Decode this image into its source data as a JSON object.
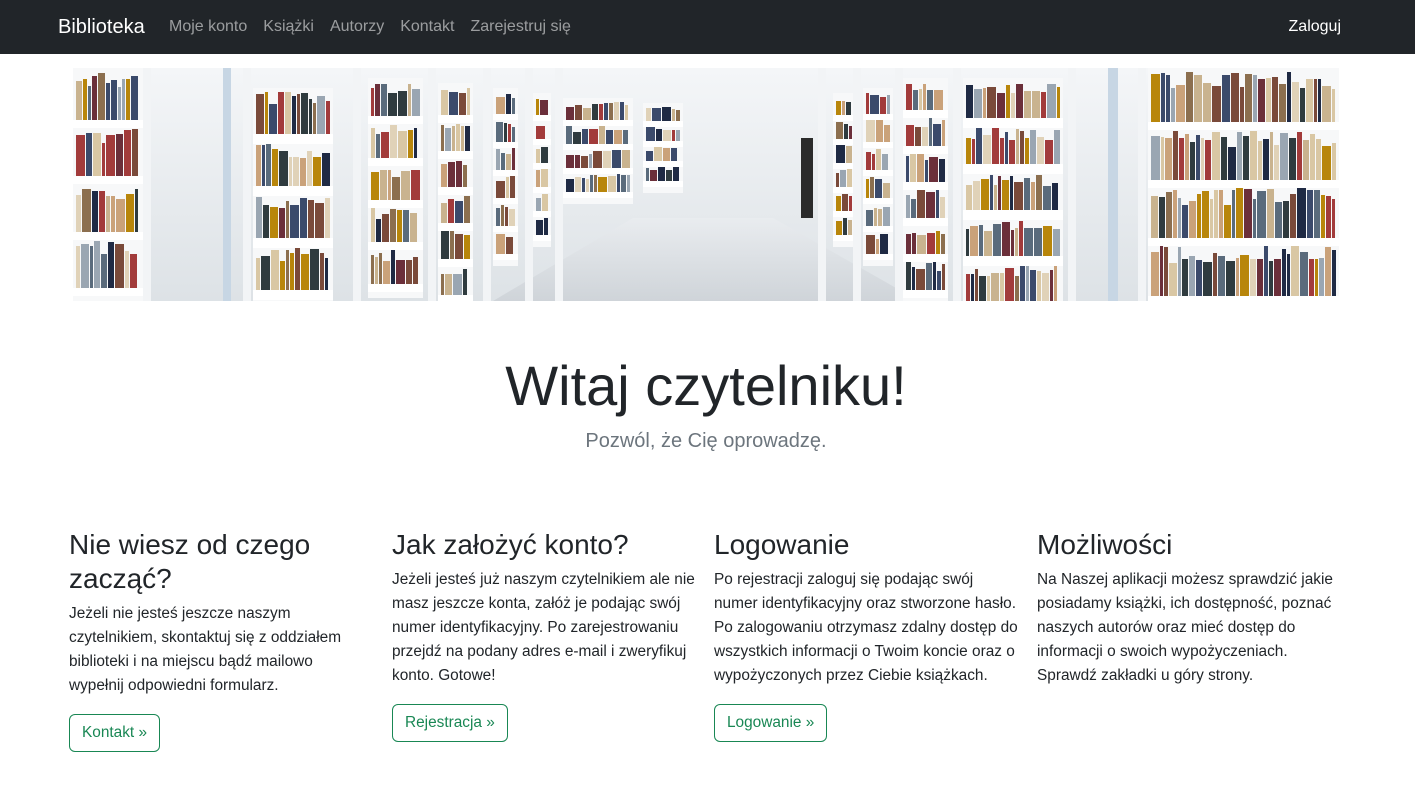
{
  "navbar": {
    "brand": "Biblioteka",
    "links": [
      "Moje konto",
      "Książki",
      "Autorzy",
      "Kontakt",
      "Zarejestruj się"
    ],
    "login": "Zaloguj"
  },
  "hero": {
    "title": "Witaj czytelniku!",
    "subtitle": "Pozwól, że Cię oprowadzę."
  },
  "features": [
    {
      "heading": "Nie wiesz od czego zacząć?",
      "text": "Jeżeli nie jesteś jeszcze naszym czytelnikiem, skontaktuj się z oddziałem biblioteki i na miejscu bądź mailowo wypełnij odpowiedni formularz.",
      "button": "Kontakt »"
    },
    {
      "heading": "Jak założyć konto?",
      "text": "Jeżeli jesteś już naszym czytelnikiem ale nie masz jeszcze konta, załóż je podając swój numer identyfikacyjny. Po zarejestrowaniu przejdź na podany adres e-mail i zweryfikuj konto. Gotowe!",
      "button": "Rejestracja »"
    },
    {
      "heading": "Logowanie",
      "text": "Po rejestracji zaloguj się podając swój numer identyfikacyjny oraz stworzone hasło. Po zalogowaniu otrzymasz zdalny dostęp do wszystkich informacji o Twoim koncie oraz o wypożyczonych przez Ciebie książkach.",
      "button": "Logowanie »"
    },
    {
      "heading": "Możliwości",
      "text": "Na Naszej aplikacji możesz sprawdzić jakie posiadamy książki, ich dostępność, poznać naszych autorów oraz mieć dostęp do informacji o swoich wypożyczeniach. Sprawdź zakładki u góry strony.",
      "button": null
    }
  ],
  "colors": {
    "navbar_bg": "#212529",
    "accent": "#198754"
  }
}
